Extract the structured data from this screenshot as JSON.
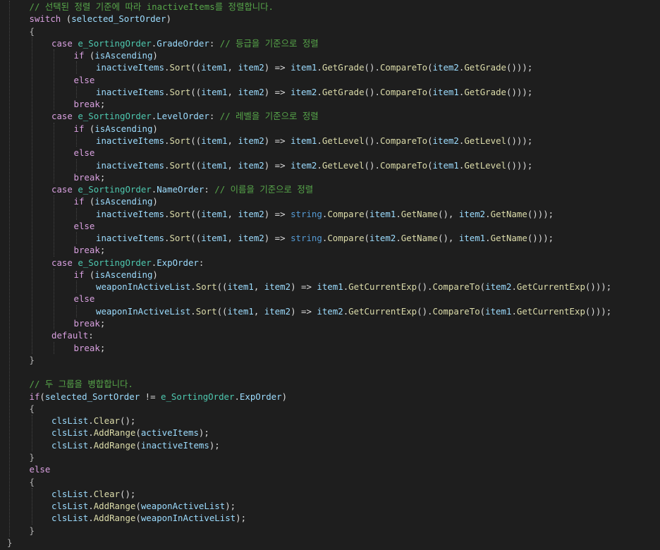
{
  "colors": {
    "background": "#1e1e1e",
    "keyword": "#569cd6",
    "control_keyword": "#d8a0df",
    "comment": "#57a64a",
    "identifier": "#9cdcfe",
    "method": "#dcdcaa",
    "type": "#4ec9b0",
    "punctuation": "#b4b4b4",
    "plain": "#dcdcdc",
    "indent_guide": "#464646"
  },
  "code_lines": [
    {
      "indent": 1,
      "tokens": [
        [
          "comment",
          "// 선택된 정렬 기준에 따라 inactiveItems를 정렬합니다."
        ]
      ]
    },
    {
      "indent": 1,
      "tokens": [
        [
          "ctrl",
          "switch"
        ],
        [
          "plain",
          " ("
        ],
        [
          "ident",
          "selected_SortOrder"
        ],
        [
          "plain",
          ")"
        ]
      ]
    },
    {
      "indent": 1,
      "tokens": [
        [
          "punct",
          "{"
        ]
      ]
    },
    {
      "indent": 2,
      "tokens": [
        [
          "ctrl",
          "case"
        ],
        [
          "plain",
          " "
        ],
        [
          "type",
          "e_SortingOrder"
        ],
        [
          "plain",
          "."
        ],
        [
          "ident",
          "GradeOrder"
        ],
        [
          "plain",
          ": "
        ],
        [
          "comment",
          "// 등급을 기준으로 정렬"
        ]
      ]
    },
    {
      "indent": 3,
      "tokens": [
        [
          "ctrl",
          "if"
        ],
        [
          "plain",
          " ("
        ],
        [
          "ident",
          "isAscending"
        ],
        [
          "plain",
          ")"
        ]
      ]
    },
    {
      "indent": 4,
      "tokens": [
        [
          "ident",
          "inactiveItems"
        ],
        [
          "plain",
          "."
        ],
        [
          "method",
          "Sort"
        ],
        [
          "plain",
          "(("
        ],
        [
          "ident",
          "item1"
        ],
        [
          "plain",
          ", "
        ],
        [
          "ident",
          "item2"
        ],
        [
          "plain",
          ") => "
        ],
        [
          "ident",
          "item1"
        ],
        [
          "plain",
          "."
        ],
        [
          "method",
          "GetGrade"
        ],
        [
          "plain",
          "()."
        ],
        [
          "method",
          "CompareTo"
        ],
        [
          "plain",
          "("
        ],
        [
          "ident",
          "item2"
        ],
        [
          "plain",
          "."
        ],
        [
          "method",
          "GetGrade"
        ],
        [
          "plain",
          "()));"
        ]
      ]
    },
    {
      "indent": 3,
      "tokens": [
        [
          "ctrl",
          "else"
        ]
      ]
    },
    {
      "indent": 4,
      "tokens": [
        [
          "ident",
          "inactiveItems"
        ],
        [
          "plain",
          "."
        ],
        [
          "method",
          "Sort"
        ],
        [
          "plain",
          "(("
        ],
        [
          "ident",
          "item1"
        ],
        [
          "plain",
          ", "
        ],
        [
          "ident",
          "item2"
        ],
        [
          "plain",
          ") => "
        ],
        [
          "ident",
          "item2"
        ],
        [
          "plain",
          "."
        ],
        [
          "method",
          "GetGrade"
        ],
        [
          "plain",
          "()."
        ],
        [
          "method",
          "CompareTo"
        ],
        [
          "plain",
          "("
        ],
        [
          "ident",
          "item1"
        ],
        [
          "plain",
          "."
        ],
        [
          "method",
          "GetGrade"
        ],
        [
          "plain",
          "()));"
        ]
      ]
    },
    {
      "indent": 3,
      "tokens": [
        [
          "ctrl",
          "break"
        ],
        [
          "plain",
          ";"
        ]
      ]
    },
    {
      "indent": 2,
      "tokens": [
        [
          "ctrl",
          "case"
        ],
        [
          "plain",
          " "
        ],
        [
          "type",
          "e_SortingOrder"
        ],
        [
          "plain",
          "."
        ],
        [
          "ident",
          "LevelOrder"
        ],
        [
          "plain",
          ": "
        ],
        [
          "comment",
          "// 레벨을 기준으로 정렬"
        ]
      ]
    },
    {
      "indent": 3,
      "tokens": [
        [
          "ctrl",
          "if"
        ],
        [
          "plain",
          " ("
        ],
        [
          "ident",
          "isAscending"
        ],
        [
          "plain",
          ")"
        ]
      ]
    },
    {
      "indent": 4,
      "tokens": [
        [
          "ident",
          "inactiveItems"
        ],
        [
          "plain",
          "."
        ],
        [
          "method",
          "Sort"
        ],
        [
          "plain",
          "(("
        ],
        [
          "ident",
          "item1"
        ],
        [
          "plain",
          ", "
        ],
        [
          "ident",
          "item2"
        ],
        [
          "plain",
          ") => "
        ],
        [
          "ident",
          "item1"
        ],
        [
          "plain",
          "."
        ],
        [
          "method",
          "GetLevel"
        ],
        [
          "plain",
          "()."
        ],
        [
          "method",
          "CompareTo"
        ],
        [
          "plain",
          "("
        ],
        [
          "ident",
          "item2"
        ],
        [
          "plain",
          "."
        ],
        [
          "method",
          "GetLevel"
        ],
        [
          "plain",
          "()));"
        ]
      ]
    },
    {
      "indent": 3,
      "tokens": [
        [
          "ctrl",
          "else"
        ]
      ]
    },
    {
      "indent": 4,
      "tokens": [
        [
          "ident",
          "inactiveItems"
        ],
        [
          "plain",
          "."
        ],
        [
          "method",
          "Sort"
        ],
        [
          "plain",
          "(("
        ],
        [
          "ident",
          "item1"
        ],
        [
          "plain",
          ", "
        ],
        [
          "ident",
          "item2"
        ],
        [
          "plain",
          ") => "
        ],
        [
          "ident",
          "item2"
        ],
        [
          "plain",
          "."
        ],
        [
          "method",
          "GetLevel"
        ],
        [
          "plain",
          "()."
        ],
        [
          "method",
          "CompareTo"
        ],
        [
          "plain",
          "("
        ],
        [
          "ident",
          "item1"
        ],
        [
          "plain",
          "."
        ],
        [
          "method",
          "GetLevel"
        ],
        [
          "plain",
          "()));"
        ]
      ]
    },
    {
      "indent": 3,
      "tokens": [
        [
          "ctrl",
          "break"
        ],
        [
          "plain",
          ";"
        ]
      ]
    },
    {
      "indent": 2,
      "tokens": [
        [
          "ctrl",
          "case"
        ],
        [
          "plain",
          " "
        ],
        [
          "type",
          "e_SortingOrder"
        ],
        [
          "plain",
          "."
        ],
        [
          "ident",
          "NameOrder"
        ],
        [
          "plain",
          ": "
        ],
        [
          "comment",
          "// 이름을 기준으로 정렬"
        ]
      ]
    },
    {
      "indent": 3,
      "tokens": [
        [
          "ctrl",
          "if"
        ],
        [
          "plain",
          " ("
        ],
        [
          "ident",
          "isAscending"
        ],
        [
          "plain",
          ")"
        ]
      ]
    },
    {
      "indent": 4,
      "tokens": [
        [
          "ident",
          "inactiveItems"
        ],
        [
          "plain",
          "."
        ],
        [
          "method",
          "Sort"
        ],
        [
          "plain",
          "(("
        ],
        [
          "ident",
          "item1"
        ],
        [
          "plain",
          ", "
        ],
        [
          "ident",
          "item2"
        ],
        [
          "plain",
          ") => "
        ],
        [
          "kw",
          "string"
        ],
        [
          "plain",
          "."
        ],
        [
          "method",
          "Compare"
        ],
        [
          "plain",
          "("
        ],
        [
          "ident",
          "item1"
        ],
        [
          "plain",
          "."
        ],
        [
          "method",
          "GetName"
        ],
        [
          "plain",
          "(), "
        ],
        [
          "ident",
          "item2"
        ],
        [
          "plain",
          "."
        ],
        [
          "method",
          "GetName"
        ],
        [
          "plain",
          "()));"
        ]
      ]
    },
    {
      "indent": 3,
      "tokens": [
        [
          "ctrl",
          "else"
        ]
      ]
    },
    {
      "indent": 4,
      "tokens": [
        [
          "ident",
          "inactiveItems"
        ],
        [
          "plain",
          "."
        ],
        [
          "method",
          "Sort"
        ],
        [
          "plain",
          "(("
        ],
        [
          "ident",
          "item1"
        ],
        [
          "plain",
          ", "
        ],
        [
          "ident",
          "item2"
        ],
        [
          "plain",
          ") => "
        ],
        [
          "kw",
          "string"
        ],
        [
          "plain",
          "."
        ],
        [
          "method",
          "Compare"
        ],
        [
          "plain",
          "("
        ],
        [
          "ident",
          "item2"
        ],
        [
          "plain",
          "."
        ],
        [
          "method",
          "GetName"
        ],
        [
          "plain",
          "(), "
        ],
        [
          "ident",
          "item1"
        ],
        [
          "plain",
          "."
        ],
        [
          "method",
          "GetName"
        ],
        [
          "plain",
          "()));"
        ]
      ]
    },
    {
      "indent": 3,
      "tokens": [
        [
          "ctrl",
          "break"
        ],
        [
          "plain",
          ";"
        ]
      ]
    },
    {
      "indent": 2,
      "tokens": [
        [
          "ctrl",
          "case"
        ],
        [
          "plain",
          " "
        ],
        [
          "type",
          "e_SortingOrder"
        ],
        [
          "plain",
          "."
        ],
        [
          "ident",
          "ExpOrder"
        ],
        [
          "plain",
          ":"
        ]
      ]
    },
    {
      "indent": 3,
      "tokens": [
        [
          "ctrl",
          "if"
        ],
        [
          "plain",
          " ("
        ],
        [
          "ident",
          "isAscending"
        ],
        [
          "plain",
          ")"
        ]
      ]
    },
    {
      "indent": 4,
      "tokens": [
        [
          "ident",
          "weaponInActiveList"
        ],
        [
          "plain",
          "."
        ],
        [
          "method",
          "Sort"
        ],
        [
          "plain",
          "(("
        ],
        [
          "ident",
          "item1"
        ],
        [
          "plain",
          ", "
        ],
        [
          "ident",
          "item2"
        ],
        [
          "plain",
          ") => "
        ],
        [
          "ident",
          "item1"
        ],
        [
          "plain",
          "."
        ],
        [
          "method",
          "GetCurrentExp"
        ],
        [
          "plain",
          "()."
        ],
        [
          "method",
          "CompareTo"
        ],
        [
          "plain",
          "("
        ],
        [
          "ident",
          "item2"
        ],
        [
          "plain",
          "."
        ],
        [
          "method",
          "GetCurrentExp"
        ],
        [
          "plain",
          "()));"
        ]
      ]
    },
    {
      "indent": 3,
      "tokens": [
        [
          "ctrl",
          "else"
        ]
      ]
    },
    {
      "indent": 4,
      "tokens": [
        [
          "ident",
          "weaponInActiveList"
        ],
        [
          "plain",
          "."
        ],
        [
          "method",
          "Sort"
        ],
        [
          "plain",
          "(("
        ],
        [
          "ident",
          "item1"
        ],
        [
          "plain",
          ", "
        ],
        [
          "ident",
          "item2"
        ],
        [
          "plain",
          ") => "
        ],
        [
          "ident",
          "item2"
        ],
        [
          "plain",
          "."
        ],
        [
          "method",
          "GetCurrentExp"
        ],
        [
          "plain",
          "()."
        ],
        [
          "method",
          "CompareTo"
        ],
        [
          "plain",
          "("
        ],
        [
          "ident",
          "item1"
        ],
        [
          "plain",
          "."
        ],
        [
          "method",
          "GetCurrentExp"
        ],
        [
          "plain",
          "()));"
        ]
      ]
    },
    {
      "indent": 3,
      "tokens": [
        [
          "ctrl",
          "break"
        ],
        [
          "plain",
          ";"
        ]
      ]
    },
    {
      "indent": 2,
      "tokens": [
        [
          "ctrl",
          "default"
        ],
        [
          "plain",
          ":"
        ]
      ]
    },
    {
      "indent": 3,
      "tokens": [
        [
          "ctrl",
          "break"
        ],
        [
          "plain",
          ";"
        ]
      ]
    },
    {
      "indent": 1,
      "tokens": [
        [
          "punct",
          "}"
        ]
      ]
    },
    {
      "indent": 0,
      "tokens": []
    },
    {
      "indent": 1,
      "tokens": [
        [
          "comment",
          "// 두 그룹을 병합합니다."
        ]
      ]
    },
    {
      "indent": 1,
      "tokens": [
        [
          "ctrl",
          "if"
        ],
        [
          "plain",
          "("
        ],
        [
          "ident",
          "selected_SortOrder"
        ],
        [
          "plain",
          " != "
        ],
        [
          "type",
          "e_SortingOrder"
        ],
        [
          "plain",
          "."
        ],
        [
          "ident",
          "ExpOrder"
        ],
        [
          "plain",
          ")"
        ]
      ]
    },
    {
      "indent": 1,
      "tokens": [
        [
          "punct",
          "{"
        ]
      ]
    },
    {
      "indent": 2,
      "tokens": [
        [
          "ident",
          "clsList"
        ],
        [
          "plain",
          "."
        ],
        [
          "method",
          "Clear"
        ],
        [
          "plain",
          "();"
        ]
      ]
    },
    {
      "indent": 2,
      "tokens": [
        [
          "ident",
          "clsList"
        ],
        [
          "plain",
          "."
        ],
        [
          "method",
          "AddRange"
        ],
        [
          "plain",
          "("
        ],
        [
          "ident",
          "activeItems"
        ],
        [
          "plain",
          ");"
        ]
      ]
    },
    {
      "indent": 2,
      "tokens": [
        [
          "ident",
          "clsList"
        ],
        [
          "plain",
          "."
        ],
        [
          "method",
          "AddRange"
        ],
        [
          "plain",
          "("
        ],
        [
          "ident",
          "inactiveItems"
        ],
        [
          "plain",
          ");"
        ]
      ]
    },
    {
      "indent": 1,
      "tokens": [
        [
          "punct",
          "}"
        ]
      ]
    },
    {
      "indent": 1,
      "tokens": [
        [
          "ctrl",
          "else"
        ]
      ]
    },
    {
      "indent": 1,
      "tokens": [
        [
          "punct",
          "{"
        ]
      ]
    },
    {
      "indent": 2,
      "tokens": [
        [
          "ident",
          "clsList"
        ],
        [
          "plain",
          "."
        ],
        [
          "method",
          "Clear"
        ],
        [
          "plain",
          "();"
        ]
      ]
    },
    {
      "indent": 2,
      "tokens": [
        [
          "ident",
          "clsList"
        ],
        [
          "plain",
          "."
        ],
        [
          "method",
          "AddRange"
        ],
        [
          "plain",
          "("
        ],
        [
          "ident",
          "weaponActiveList"
        ],
        [
          "plain",
          ");"
        ]
      ]
    },
    {
      "indent": 2,
      "tokens": [
        [
          "ident",
          "clsList"
        ],
        [
          "plain",
          "."
        ],
        [
          "method",
          "AddRange"
        ],
        [
          "plain",
          "("
        ],
        [
          "ident",
          "weaponInActiveList"
        ],
        [
          "plain",
          ");"
        ]
      ]
    },
    {
      "indent": 1,
      "tokens": [
        [
          "punct",
          "}"
        ]
      ]
    },
    {
      "indent": 0,
      "tokens": [
        [
          "punct",
          "}"
        ]
      ]
    }
  ]
}
